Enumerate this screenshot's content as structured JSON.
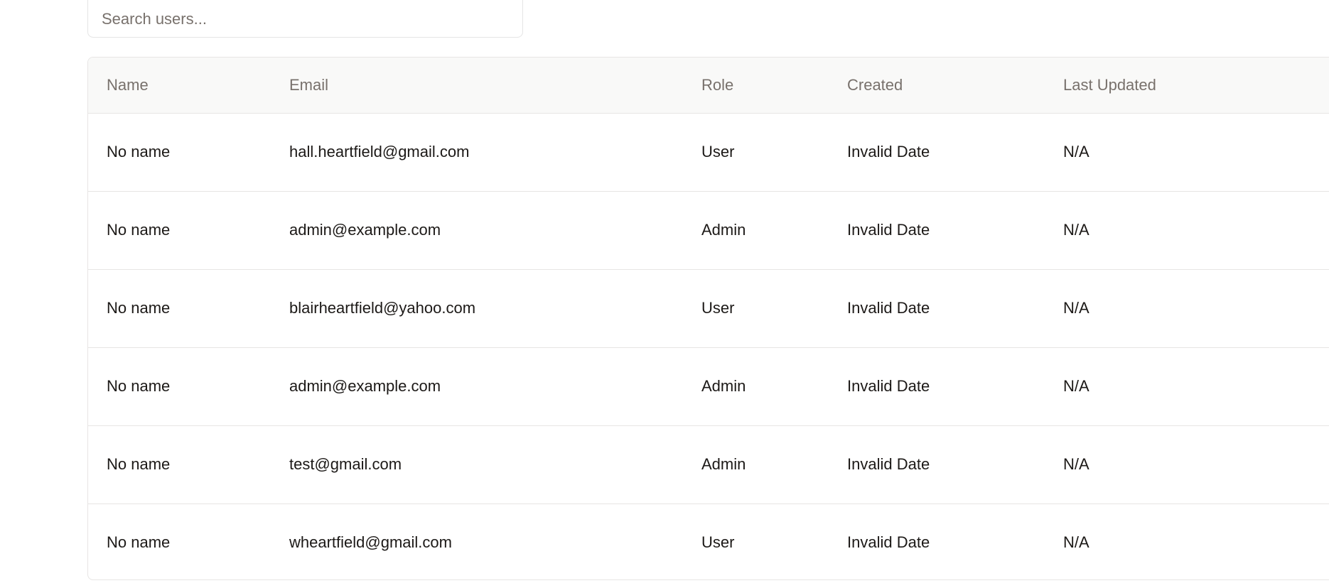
{
  "search": {
    "placeholder": "Search users...",
    "value": ""
  },
  "table": {
    "columns": [
      "Name",
      "Email",
      "Role",
      "Created",
      "Last Updated"
    ],
    "rows": [
      {
        "name": "No name",
        "email": "hall.heartfield@gmail.com",
        "role": "User",
        "created": "Invalid Date",
        "updated": "N/A"
      },
      {
        "name": "No name",
        "email": "admin@example.com",
        "role": "Admin",
        "created": "Invalid Date",
        "updated": "N/A"
      },
      {
        "name": "No name",
        "email": "blairheartfield@yahoo.com",
        "role": "User",
        "created": "Invalid Date",
        "updated": "N/A"
      },
      {
        "name": "No name",
        "email": "admin@example.com",
        "role": "Admin",
        "created": "Invalid Date",
        "updated": "N/A"
      },
      {
        "name": "No name",
        "email": "test@gmail.com",
        "role": "Admin",
        "created": "Invalid Date",
        "updated": "N/A"
      },
      {
        "name": "No name",
        "email": "wheartfield@gmail.com",
        "role": "User",
        "created": "Invalid Date",
        "updated": "N/A"
      }
    ]
  }
}
